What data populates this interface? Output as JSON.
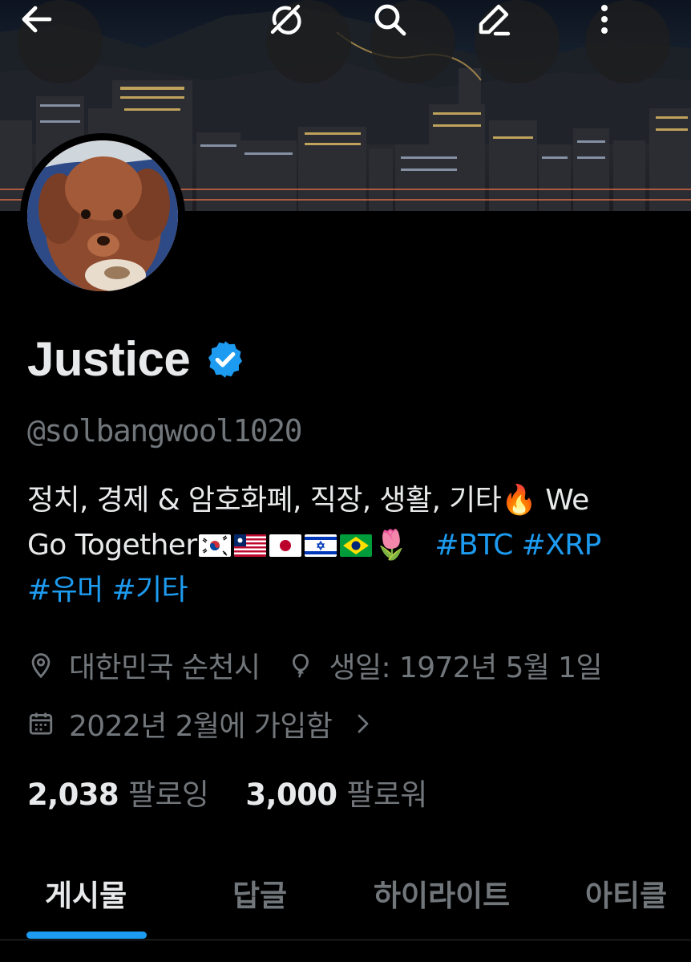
{
  "header": {
    "back_icon": "arrow-left-icon",
    "grok_icon": "grok-icon",
    "search_icon": "search-icon",
    "edit_icon": "pencil-icon",
    "more_icon": "more-vertical-icon"
  },
  "profile": {
    "display_name": "Justice",
    "verified": true,
    "handle": "@solbangwool1020",
    "bio_text_1": "정치, 경제 & 암호화폐, 직장, 생활, 기타🔥 We",
    "bio_text_2": "Go Together",
    "bio_flags": [
      "KR",
      "LR",
      "JP",
      "IL",
      "BR"
    ],
    "bio_tulip": "🌷",
    "hashtags": [
      "#BTC",
      "#XRP",
      "#유머",
      "#기타"
    ],
    "location": "대한민국 순천시",
    "birthday": "생일: 1972년 5월 1일",
    "joined": "2022년 2월에 가입함",
    "following_count": "2,038",
    "following_label": "팔로잉",
    "followers_count": "3,000",
    "followers_label": "팔로워"
  },
  "tabs": [
    {
      "label": "게시물",
      "active": true
    },
    {
      "label": "답글",
      "active": false
    },
    {
      "label": "하이라이트",
      "active": false
    },
    {
      "label": "아티클",
      "active": false
    }
  ],
  "colors": {
    "background": "#000000",
    "primary_text": "#e7e9ea",
    "secondary_text": "#71767b",
    "accent": "#1d9bf0"
  }
}
